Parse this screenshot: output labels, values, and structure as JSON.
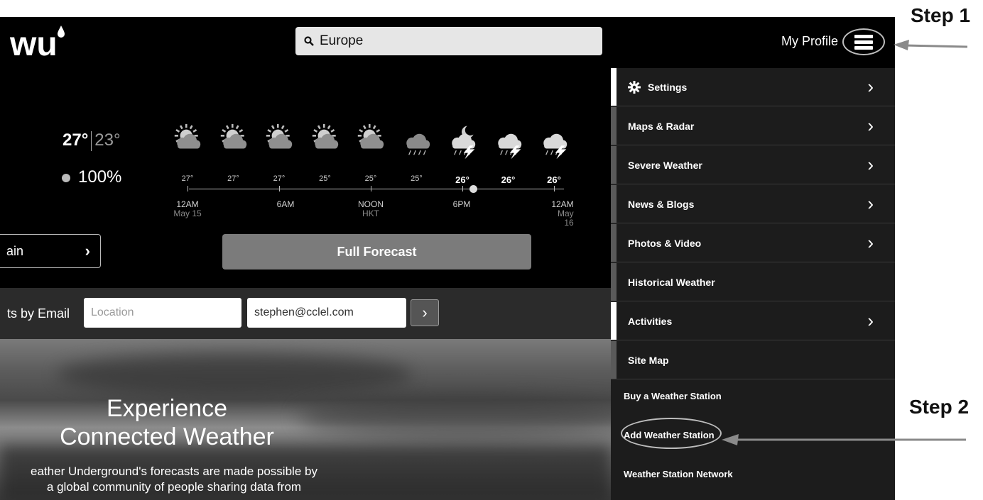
{
  "header": {
    "logo_text": "wu",
    "search_value": "Europe",
    "profile_label": "My Profile",
    "menu_icon": "hamburger-icon"
  },
  "current": {
    "high": "27°",
    "low": "23°",
    "precip": "100%"
  },
  "hourly": {
    "temps": [
      "27°",
      "27°",
      "27°",
      "25°",
      "25°",
      "25°",
      "26°",
      "26°",
      "26°"
    ],
    "icons": [
      "partly-sunny",
      "partly-sunny",
      "partly-sunny",
      "partly-sunny",
      "partly-sunny",
      "rain",
      "night-thunderstorm",
      "thunderstorm",
      "thunderstorm"
    ],
    "times": [
      {
        "label": "12AM",
        "sub": "May 15"
      },
      {
        "label": "6AM",
        "sub": ""
      },
      {
        "label": "NOON",
        "sub": "HKT"
      },
      {
        "label": "6PM",
        "sub": ""
      },
      {
        "label": "12AM",
        "sub": "May 16"
      }
    ]
  },
  "buttons": {
    "again": "ain",
    "full_forecast": "Full Forecast"
  },
  "email_alerts": {
    "label": "ts by Email",
    "location_placeholder": "Location",
    "email_value": "stephen@cclel.com"
  },
  "hero": {
    "title_line1": "Experience",
    "title_line2": "Connected Weather",
    "desc_line1": "eather Underground's forecasts are made possible by",
    "desc_line2": "a global community of people sharing data from"
  },
  "menu": {
    "items": [
      {
        "label": "Settings"
      },
      {
        "label": "Maps & Radar"
      },
      {
        "label": "Severe Weather"
      },
      {
        "label": "News & Blogs"
      },
      {
        "label": "Photos & Video"
      },
      {
        "label": "Historical Weather"
      },
      {
        "label": "Activities"
      },
      {
        "label": "Site Map"
      }
    ],
    "links": [
      "Buy a Weather Station",
      "Add Weather Station",
      "Weather Station Network"
    ]
  },
  "annotations": {
    "step1": "Step 1",
    "step2": "Step 2"
  }
}
